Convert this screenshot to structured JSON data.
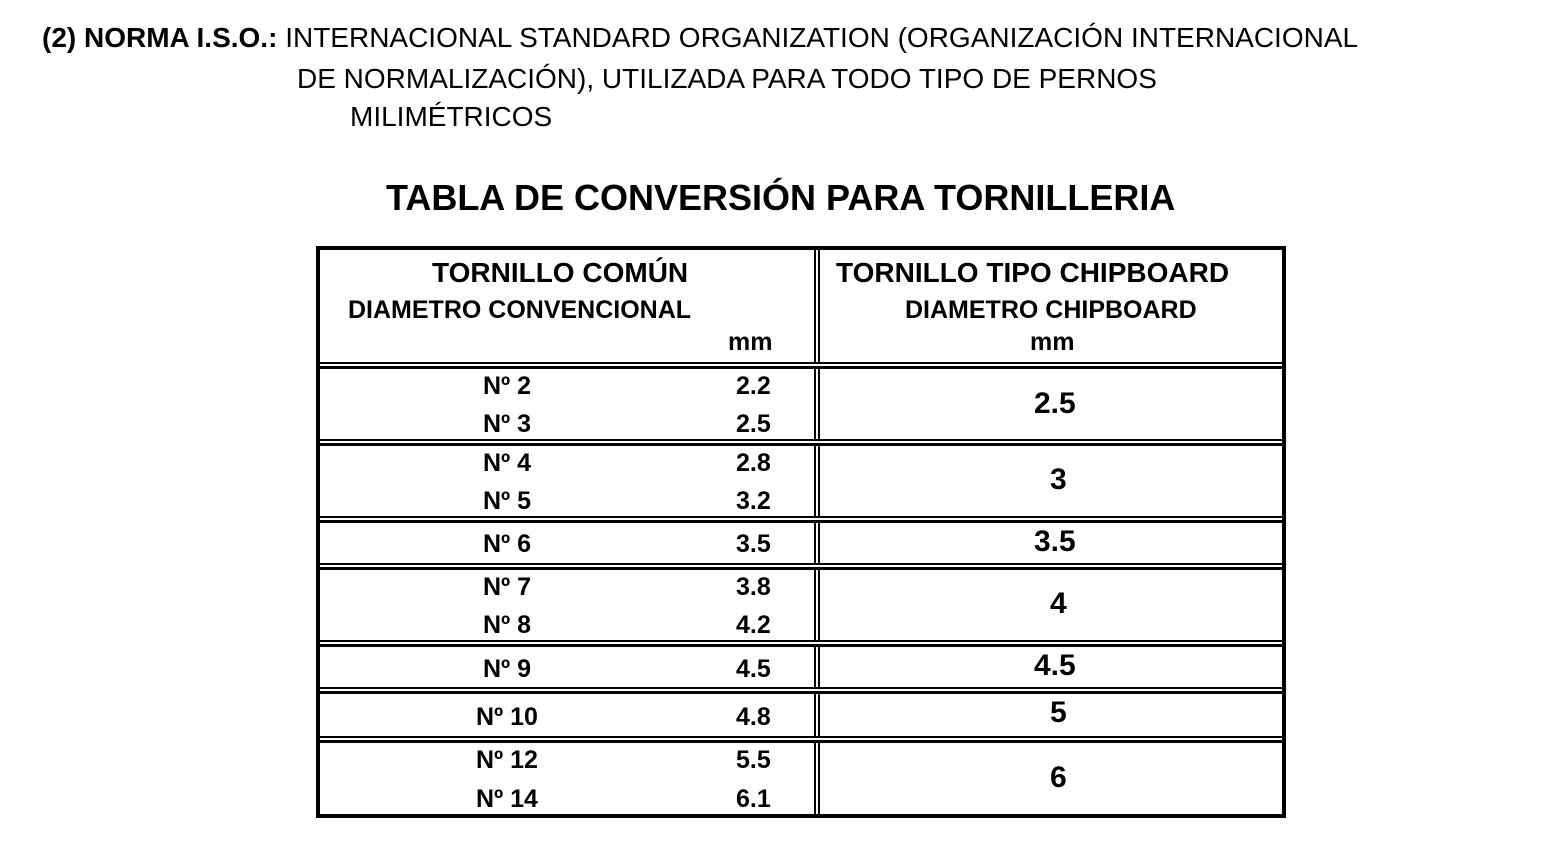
{
  "intro": {
    "label": "(2) NORMA I.S.O.:",
    "line1_text": "INTERNACIONAL STANDARD ORGANIZATION (ORGANIZACIÓN INTERNACIONAL",
    "line2_text": "DE NORMALIZACIÓN),  UTILIZADA PARA TODO TIPO DE PERNOS",
    "line3_text": "MILIMÉTRICOS"
  },
  "table_title": "TABLA DE CONVERSIÓN PARA TORNILLERIA",
  "headers": {
    "left_title": "TORNILLO COMÚN",
    "left_subtitle": "DIAMETRO CONVENCIONAL",
    "left_unit": "mm",
    "right_title": "TORNILLO TIPO CHIPBOARD",
    "right_subtitle": "DIAMETRO CHIPBOARD",
    "right_unit": "mm"
  },
  "groups": [
    {
      "items": [
        {
          "number": "Nº 2",
          "mm": "2.2"
        },
        {
          "number": "Nº 3",
          "mm": "2.5"
        }
      ],
      "chipboard": "2.5"
    },
    {
      "items": [
        {
          "number": "Nº 4",
          "mm": "2.8"
        },
        {
          "number": "Nº 5",
          "mm": "3.2"
        }
      ],
      "chipboard": "3"
    },
    {
      "items": [
        {
          "number": "Nº 6",
          "mm": "3.5"
        }
      ],
      "chipboard": "3.5"
    },
    {
      "items": [
        {
          "number": "Nº 7",
          "mm": "3.8"
        },
        {
          "number": "Nº 8",
          "mm": "4.2"
        }
      ],
      "chipboard": "4"
    },
    {
      "items": [
        {
          "number": "Nº 9",
          "mm": "4.5"
        }
      ],
      "chipboard": "4.5"
    },
    {
      "items": [
        {
          "number": "Nº 10",
          "mm": "4.8"
        }
      ],
      "chipboard": "5"
    },
    {
      "items": [
        {
          "number": "Nº 12",
          "mm": "5.5"
        },
        {
          "number": "Nº 14",
          "mm": "6.1"
        }
      ],
      "chipboard": "6"
    }
  ]
}
